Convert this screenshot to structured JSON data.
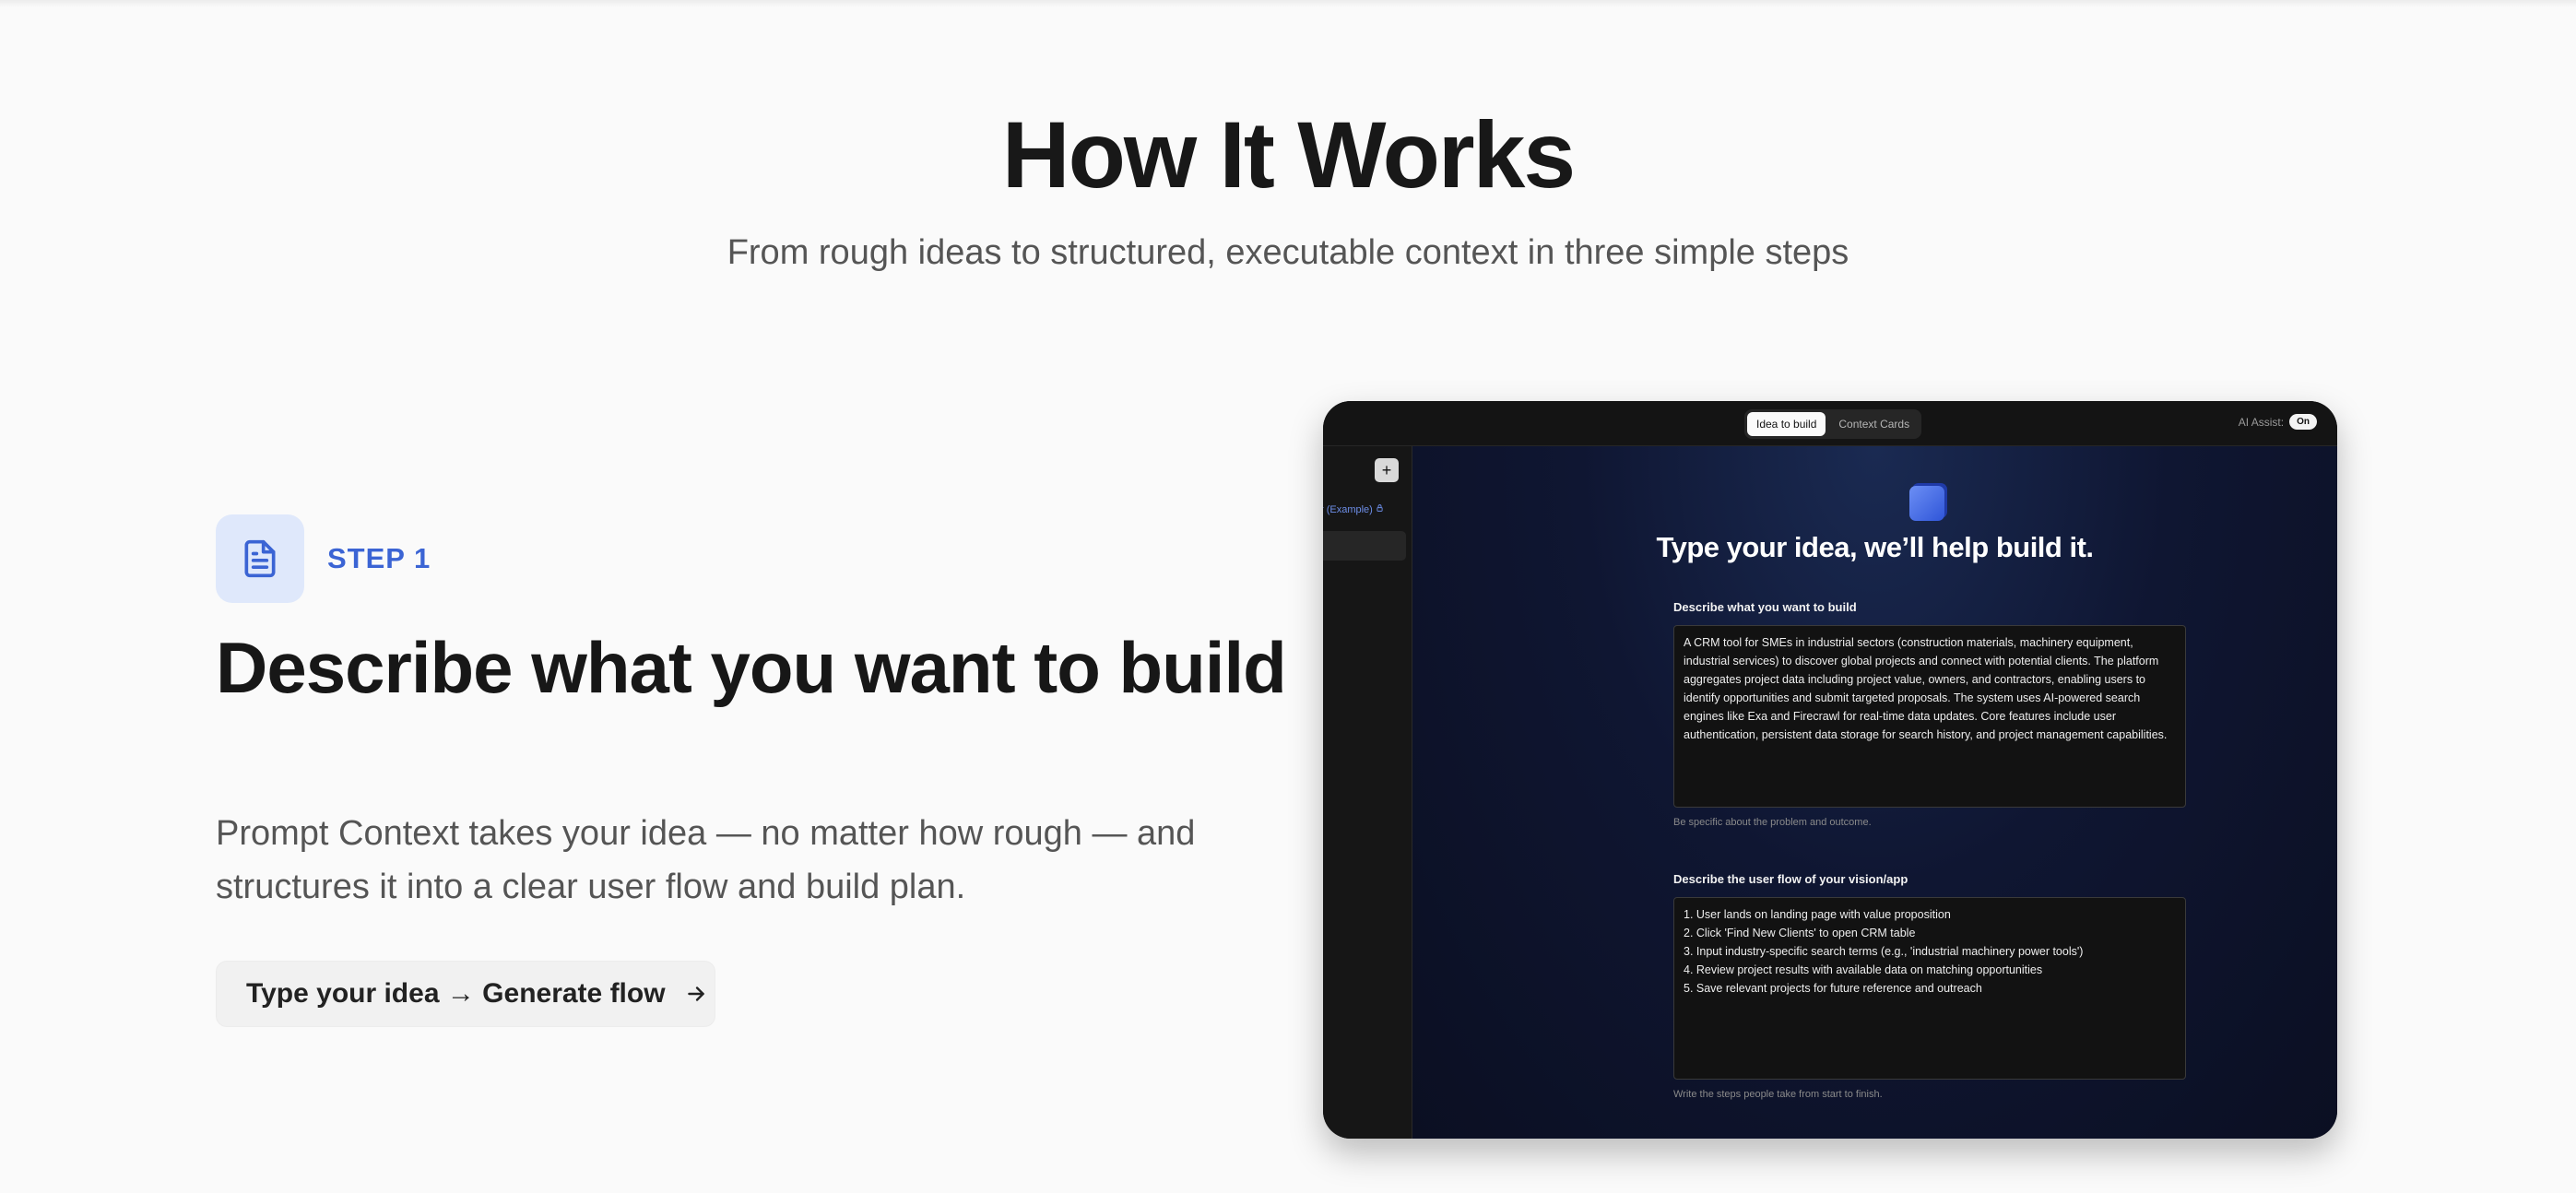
{
  "section": {
    "title": "How It Works",
    "subtitle": "From rough ideas to structured, executable context in three simple steps"
  },
  "step": {
    "label": "STEP 1",
    "title": "Describe what you want to build",
    "description": "Prompt Context takes your idea — no matter how rough — and structures it into a clear user flow and build plan.",
    "cta_label": "Type your idea → Generate flow",
    "icon": "document-icon",
    "accent": "#3b64d4"
  },
  "app": {
    "tabs": [
      {
        "label": "Idea to build",
        "active": true
      },
      {
        "label": "Context Cards",
        "active": false
      }
    ],
    "ai_assist_label": "AI Assist:",
    "ai_assist_state": "On",
    "sidebar": {
      "plus_label": "+",
      "item_label": "r (Example)"
    },
    "main_title": "Type your idea, we’ll help build it.",
    "field1": {
      "label": "Describe what you want to build",
      "value": "A CRM tool for SMEs in industrial sectors (construction materials, machinery equipment, industrial services) to discover global projects and connect with potential clients. The platform aggregates project data including project value, owners, and contractors, enabling users to identify opportunities and submit targeted proposals. The system uses AI-powered search engines like Exa and Firecrawl for real-time data updates. Core features include user authentication, persistent data storage for search history, and project management capabilities.",
      "hint": "Be specific about the problem and outcome."
    },
    "field2": {
      "label": "Describe the user flow of your vision/app",
      "value": "1. User lands on landing page with value proposition\n2. Click 'Find New Clients' to open CRM table\n3. Input industry-specific search terms (e.g., 'industrial machinery power tools')\n4. Review project results with available data on matching opportunities\n5. Save relevant projects for future reference and outreach",
      "hint": "Write the steps people take from start to finish."
    }
  }
}
